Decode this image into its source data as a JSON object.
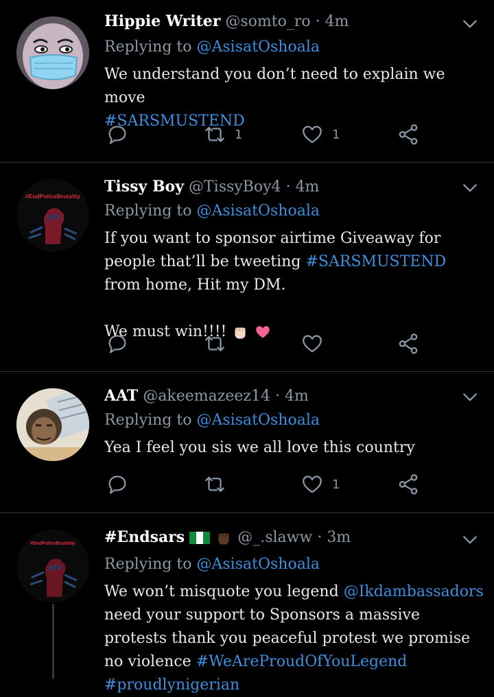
{
  "tweets": [
    {
      "name": "Hippie Writer",
      "handle": "@somto_ro",
      "sep": "·",
      "time": "4m",
      "replying_prefix": "Replying to",
      "replying_to": "@AsisatOshoala",
      "text1": "We understand you don’t need to explain we move",
      "hashtag1": "#SARSMUSTEND",
      "retweets": "1",
      "likes": "1"
    },
    {
      "name": "Tissy Boy",
      "handle": "@TissyBoy4",
      "sep": "·",
      "time": "4m",
      "avatar_text": "#EndPoliceBrutality",
      "replying_prefix": "Replying to",
      "replying_to": "@AsisatOshoala",
      "text1": "If you want to sponsor airtime Giveaway for people that’ll be tweeting",
      "hashtag1": "#SARSMUSTEND",
      "text2": "from home, Hit my DM.",
      "text3": "We must win!!!!"
    },
    {
      "name": "AAT",
      "handle": "@akeemazeez14",
      "sep": "·",
      "time": "4m",
      "replying_prefix": "Replying to",
      "replying_to": "@AsisatOshoala",
      "text1": "Yea I feel you sis we all love this country",
      "likes": "1"
    },
    {
      "name": "#Endsars",
      "handle": "@_.slaww",
      "sep": "·",
      "time": "3m",
      "avatar_text": "#EndPoliceBrutality",
      "replying_prefix": "Replying to",
      "replying_to": "@AsisatOshoala",
      "text1": "We won’t misquote you legend",
      "mention1": "@Ikdambassadors",
      "text2": "need your support to Sponsors a massive protests thank you peaceful protest we promise no violence",
      "hashtag1": "#WeAreProudOfYouLegend",
      "hashtag2": "#proudlynigerian"
    }
  ],
  "colors": {
    "background": "#000000",
    "link": "#3d8fe0",
    "muted": "#8b98a5",
    "divider": "#2f3336"
  }
}
